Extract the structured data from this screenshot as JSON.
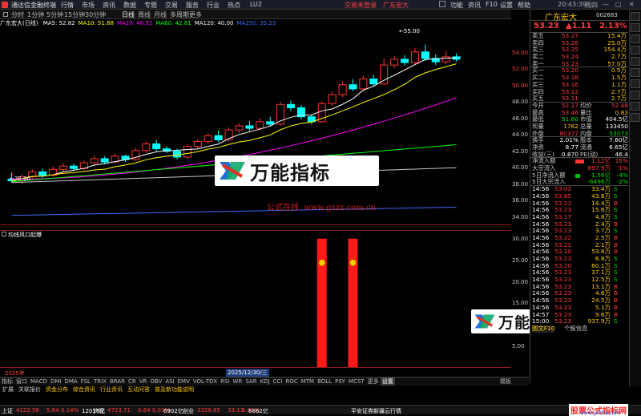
{
  "titlebar": {
    "app_title": "通达信金融终端",
    "menu": [
      "行情",
      "市场",
      "资讯",
      "数据",
      "专题",
      "交易",
      "服务",
      "行业",
      "热点",
      "LU2"
    ],
    "trade_login": "交易未登录",
    "stock_name": "广东宏大",
    "right_menu": [
      "功能",
      "资讯",
      "F10",
      "设置",
      "帮助"
    ],
    "time": "20:43:39",
    "time_label": "周四"
  },
  "tabs": [
    "分时",
    "1分钟",
    "5分钟",
    "15分钟",
    "30分钟",
    "日线",
    "周线",
    "月线",
    "多周期",
    "更多"
  ],
  "active_tab": "日线",
  "ma_line": {
    "stock": "广东宏大(日线)",
    "items": [
      {
        "label": "MA5",
        "value": "52.82",
        "color": "#ffffff"
      },
      {
        "label": "MA10",
        "value": "51.88",
        "color": "#ffff00"
      },
      {
        "label": "MA20",
        "value": "48.52",
        "color": "#ff00ff"
      },
      {
        "label": "MA60",
        "value": "42.81",
        "color": "#00ff00"
      },
      {
        "label": "MA120",
        "value": "40.00",
        "color": "#ffffff"
      },
      {
        "label": "MA250",
        "value": "35.23",
        "color": "#3f6bff"
      }
    ]
  },
  "main_axis": [
    "54.00",
    "52.00",
    "50.00",
    "48.00",
    "46.00",
    "44.00",
    "42.00",
    "40.00",
    "38.00",
    "36.00",
    "34.00"
  ],
  "sub_axis": [
    "30.00",
    "25.00",
    "20.00",
    "15.00",
    "10.00",
    "5.00"
  ],
  "annotations": {
    "high": "55.00",
    "low": "38.00"
  },
  "watermark": {
    "brand": "万能指标",
    "site_cn": "公式在线",
    "site_url": "www.gszx.com.cn"
  },
  "sub_indicator": "均线风口起爆",
  "date_labels": {
    "left": "2025年",
    "cursor": "2025/12/30/三"
  },
  "bottom_tabs": [
    "指标",
    "窗口",
    "MACD",
    "DMI",
    "DMA",
    "FSL",
    "TRIX",
    "BRAR",
    "CR",
    "VR",
    "OBV",
    "ASI",
    "EMV",
    "VOL-TDX",
    "RSI",
    "WR",
    "SAR",
    "KDJ",
    "CCI",
    "ROC",
    "MTM",
    "BOLL",
    "PSY",
    "MCST",
    "更多",
    "设置"
  ],
  "bottom_tabs_right": [
    "模板",
    "统计"
  ],
  "toolbar2": [
    "扩展",
    "关联报价",
    "资金分布",
    "综合资讯",
    "行业资讯",
    "互动问答",
    "普及新功能说明"
  ],
  "quote": {
    "name": "广东宏大",
    "code": "002683",
    "price": "53.23",
    "change": "▲1.11",
    "pct": "2.13%",
    "sells": [
      {
        "label": "卖五",
        "price": "53.27",
        "vol": "15.4万"
      },
      {
        "label": "卖四",
        "price": "53.26",
        "vol": "25.0万"
      },
      {
        "label": "卖三",
        "price": "53.25",
        "vol": "154.4万"
      },
      {
        "label": "卖二",
        "price": "53.24",
        "vol": "2.7万"
      },
      {
        "label": "卖一",
        "price": "53.23",
        "vol": "57.0万"
      }
    ],
    "buys": [
      {
        "label": "买一",
        "price": "53.20",
        "vol": "0.5万"
      },
      {
        "label": "买二",
        "price": "53.18",
        "vol": "1.5万"
      },
      {
        "label": "买三",
        "price": "53.16",
        "vol": "1.1万"
      },
      {
        "label": "买四",
        "price": "53.12",
        "vol": "2.7万"
      },
      {
        "label": "买五",
        "price": "53.11",
        "vol": "2.7万"
      }
    ],
    "stats": [
      {
        "l1": "今开",
        "v1": "52.17",
        "c1": "red",
        "l2": "均价",
        "v2": "52.48",
        "c2": "red"
      },
      {
        "l1": "最高",
        "v1": "53.46",
        "c1": "red",
        "l2": "量比",
        "v2": "0.83",
        "c2": "yel"
      },
      {
        "l1": "最低",
        "v1": "51.60",
        "c1": "grn",
        "l2": "市值",
        "v2": "404.5亿",
        "c2": "wht"
      },
      {
        "l1": "现量",
        "v1": "1762",
        "c1": "yel",
        "l2": "总量",
        "v2": "133450",
        "c2": "wht"
      },
      {
        "l1": "外盘",
        "v1": "80377",
        "c1": "red",
        "l2": "内盘",
        "v2": "53073",
        "c2": "grn"
      }
    ],
    "stats2": [
      {
        "l1": "换手",
        "v1": "2.01%",
        "c1": "wht",
        "l2": "股本",
        "v2": "7.60亿",
        "c2": "wht"
      },
      {
        "l1": "净资",
        "v1": "8.77",
        "c1": "wht",
        "l2": "流通",
        "v2": "6.65亿",
        "c2": "wht"
      },
      {
        "l1": "收益(三)",
        "v1": "0.870",
        "c1": "wht",
        "l2": "PE(动)",
        "v2": "46.4",
        "c2": "wht"
      }
    ],
    "flows": [
      {
        "label": "净流入额",
        "value": "1.12亿",
        "pct": "16%",
        "c": "red",
        "bar": 0.7
      },
      {
        "label": "大宗流入",
        "value": "897.9万",
        "pct": "1%",
        "c": "red",
        "bar": 0.0
      },
      {
        "label": "5日净流入额",
        "value": "-1.56亿",
        "pct": "-4%",
        "c": "grn",
        "bar": 0.4
      },
      {
        "label": "5日大宗流入",
        "value": "-6496万",
        "pct": "-2%",
        "c": "grn",
        "bar": 0.0
      }
    ],
    "ticks": [
      [
        "14:56",
        "53.02",
        "33.4万",
        "S"
      ],
      [
        "14:56",
        "53.85",
        "43.8万",
        "S"
      ],
      [
        "14:56",
        "53.23",
        "14.4万",
        "B"
      ],
      [
        "14:56",
        "53.23",
        "15.6万",
        "S"
      ],
      [
        "14:56",
        "53.17",
        "4.8万",
        "S"
      ],
      [
        "14:56",
        "53.23",
        "2.4万",
        "B"
      ],
      [
        "14:56",
        "53.23",
        "3.7万",
        "S"
      ],
      [
        "14:56",
        "53.22",
        "2.5万",
        "B"
      ],
      [
        "14:56",
        "53.21",
        "2.1万",
        "B"
      ],
      [
        "14:56",
        "53.20",
        "53.8万",
        "B"
      ],
      [
        "14:56",
        "53.23",
        "6.8万",
        "S"
      ],
      [
        "14:56",
        "53.20",
        "60.1万",
        "S"
      ],
      [
        "14:56",
        "53.23",
        "37.1万",
        "S"
      ],
      [
        "14:56",
        "53.23",
        "12.5万",
        "S"
      ],
      [
        "14:56",
        "53.23",
        "13.1万",
        "B"
      ],
      [
        "14:56",
        "53.23",
        "4.6万",
        "B"
      ],
      [
        "14:56",
        "53.23",
        "24.5万",
        "B"
      ],
      [
        "14:56",
        "53.23",
        "5.1万",
        "B"
      ],
      [
        "14:57",
        "53.23",
        "9.6万",
        "B"
      ],
      [
        "15:00",
        "53.23",
        "937.9万",
        "S"
      ]
    ],
    "footer_left": "图文F10",
    "footer_right": "个股信息"
  },
  "statusbar": [
    {
      "label": "上证",
      "v": "4122.58",
      "d": "5.64",
      "p": "0.14%",
      "amt": "12018亿"
    },
    {
      "label": "沪深",
      "v": "4723.71",
      "d": "0.64",
      "p": "0.01%",
      "amt": "6902亿"
    },
    {
      "label": "创业",
      "v": "3328.65",
      "d": "33.13",
      "p": "1.01%",
      "amt": "6862亿"
    }
  ],
  "statusbar_server": "平安证券新疆云行情",
  "statusbar_logo": "股票公式指标网",
  "statusbar_logo_url": "www.gszbw.com",
  "chart_data": {
    "type": "candlestick",
    "ylim": [
      33,
      57
    ],
    "candles": [
      [
        38.6,
        38.4,
        39.4,
        38.2
      ],
      [
        38.4,
        38.9,
        39.2,
        38.0
      ],
      [
        38.9,
        39.5,
        39.8,
        38.7
      ],
      [
        39.5,
        39.1,
        39.9,
        38.8
      ],
      [
        39.1,
        39.8,
        40.2,
        38.9
      ],
      [
        39.8,
        40.2,
        40.6,
        39.5
      ],
      [
        40.2,
        39.9,
        40.5,
        39.6
      ],
      [
        39.9,
        40.6,
        40.9,
        39.7
      ],
      [
        40.6,
        41.1,
        41.5,
        40.4
      ],
      [
        41.1,
        40.7,
        41.4,
        40.4
      ],
      [
        40.7,
        41.4,
        41.7,
        40.5
      ],
      [
        41.4,
        41.0,
        41.6,
        40.7
      ],
      [
        41.0,
        42.1,
        42.4,
        40.8
      ],
      [
        42.1,
        42.9,
        43.2,
        41.8
      ],
      [
        42.9,
        42.3,
        43.4,
        42.0
      ],
      [
        42.3,
        42.0,
        42.6,
        41.8
      ],
      [
        42.0,
        41.3,
        42.3,
        41.0
      ],
      [
        41.3,
        42.6,
        42.9,
        41.1
      ],
      [
        42.6,
        43.2,
        43.5,
        42.3
      ],
      [
        43.2,
        43.9,
        44.2,
        42.9
      ],
      [
        43.9,
        43.4,
        44.5,
        43.1
      ],
      [
        43.4,
        44.6,
        44.9,
        43.2
      ],
      [
        44.6,
        45.1,
        45.4,
        44.2
      ],
      [
        45.1,
        44.8,
        45.7,
        44.4
      ],
      [
        44.8,
        45.6,
        46.0,
        44.5
      ],
      [
        45.6,
        45.3,
        46.2,
        45.0
      ],
      [
        45.3,
        47.7,
        48.0,
        45.1
      ],
      [
        47.7,
        47.3,
        48.2,
        46.9
      ],
      [
        47.3,
        46.2,
        47.6,
        45.9
      ],
      [
        46.2,
        45.6,
        46.5,
        45.3
      ],
      [
        45.6,
        47.8,
        48.1,
        45.5
      ],
      [
        47.8,
        48.9,
        49.3,
        47.5
      ],
      [
        48.9,
        50.1,
        50.5,
        48.6
      ],
      [
        50.1,
        49.6,
        50.8,
        49.3
      ],
      [
        49.6,
        50.8,
        51.2,
        49.4
      ],
      [
        50.8,
        50.2,
        51.3,
        49.9
      ],
      [
        50.2,
        52.5,
        53.3,
        50.0
      ],
      [
        52.5,
        53.2,
        53.6,
        52.1
      ],
      [
        53.2,
        52.8,
        53.7,
        52.4
      ],
      [
        52.8,
        54.1,
        54.6,
        52.6
      ],
      [
        54.1,
        53.3,
        55.0,
        53.0
      ],
      [
        53.3,
        52.9,
        53.8,
        52.5
      ],
      [
        52.9,
        53.5,
        54.2,
        52.6
      ],
      [
        53.5,
        53.2,
        53.9,
        52.9
      ]
    ],
    "sub_signals": [
      {
        "index": 30,
        "value": 30
      },
      {
        "index": 33,
        "value": 30
      }
    ],
    "sub_ylim": [
      0,
      32
    ]
  }
}
